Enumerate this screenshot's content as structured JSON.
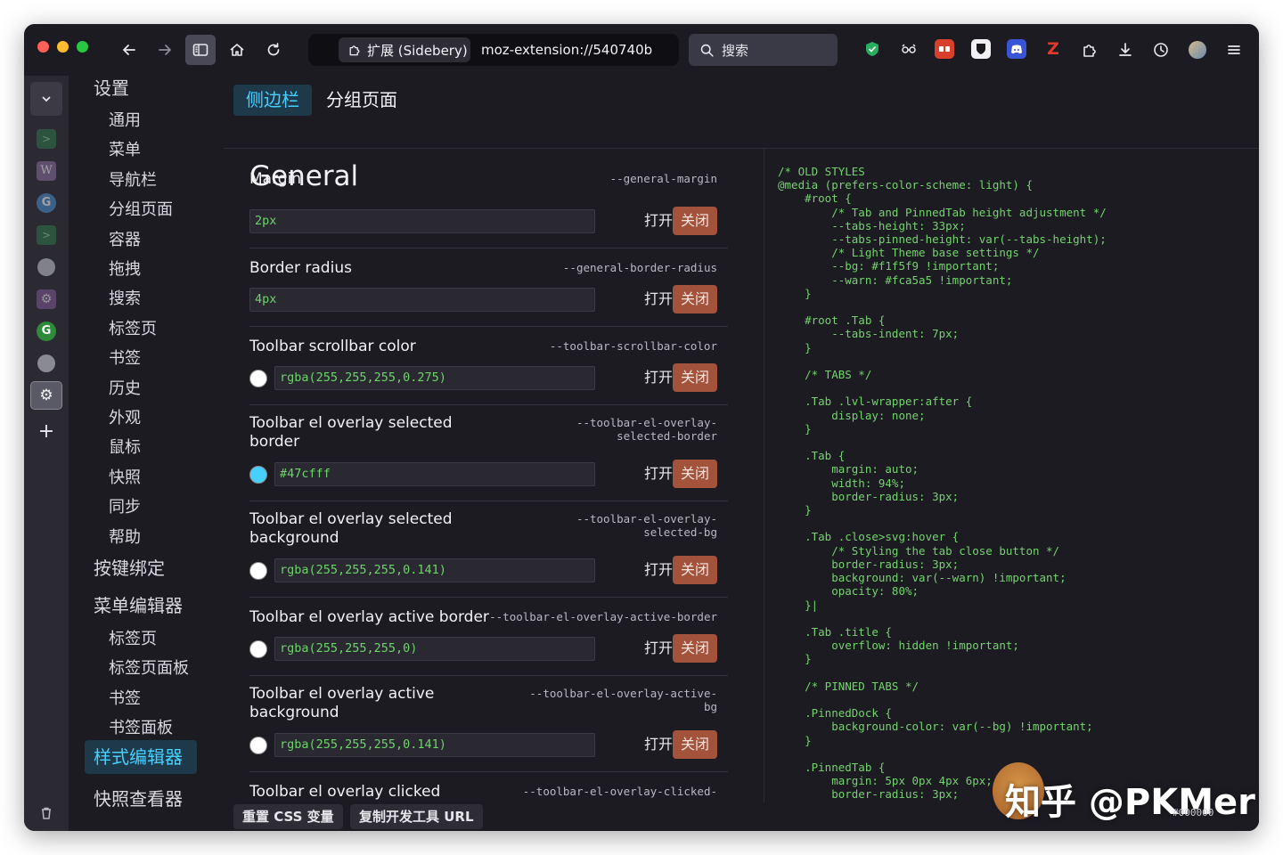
{
  "toolbar": {
    "ext_chip_label": "扩展 (Sidebery)",
    "url": "moz-extension://540740b",
    "search_placeholder": "搜索"
  },
  "nav": {
    "settings_heading": "设置",
    "settings_items": [
      "通用",
      "菜单",
      "导航栏",
      "分组页面",
      "容器",
      "拖拽",
      "搜索",
      "标签页",
      "书签",
      "历史",
      "外观",
      "鼠标",
      "快照",
      "同步",
      "帮助"
    ],
    "keybindings": "按键绑定",
    "menu_editor": "菜单编辑器",
    "menu_editor_items": [
      "标签页",
      "标签页面板",
      "书签",
      "书签面板"
    ],
    "style_editor": "样式编辑器",
    "snapshot_viewer": "快照查看器"
  },
  "tabs": {
    "sidebar": "侧边栏",
    "group_page": "分组页面"
  },
  "settings": {
    "section_title": "General",
    "open_label": "打开",
    "close_label": "关闭",
    "rows": [
      {
        "title": "Margin",
        "var": "--general-margin",
        "value": "2px"
      },
      {
        "title": "Border radius",
        "var": "--general-border-radius",
        "value": "4px"
      },
      {
        "title": "Toolbar scrollbar color",
        "var": "--toolbar-scrollbar-color",
        "value": "rgba(255,255,255,0.275)",
        "color": "#ffffff"
      },
      {
        "title": "Toolbar el overlay selected border",
        "var": "--toolbar-el-overlay-selected-border",
        "value": "#47cfff",
        "color": "#47cfff"
      },
      {
        "title": "Toolbar el overlay selected background",
        "var": "--toolbar-el-overlay-selected-bg",
        "value": "rgba(255,255,255,0.141)",
        "color": "#ffffff"
      },
      {
        "title": "Toolbar el overlay active border",
        "var": "--toolbar-el-overlay-active-border",
        "value": "rgba(255,255,255,0)",
        "color": "#ffffff"
      },
      {
        "title": "Toolbar el overlay active background",
        "var": "--toolbar-el-overlay-active-bg",
        "value": "rgba(255,255,255,0.141)",
        "color": "#ffffff"
      },
      {
        "title": "Toolbar el overlay clicked",
        "var": "--toolbar-el-overlay-clicked-"
      }
    ]
  },
  "editor": {
    "code": "/* OLD STYLES\n@media (prefers-color-scheme: light) {\n    #root {\n        /* Tab and PinnedTab height adjustment */\n        --tabs-height: 33px;\n        --tabs-pinned-height: var(--tabs-height);\n        /* Light Theme base settings */\n        --bg: #f1f5f9 !important;\n        --warn: #fca5a5 !important;\n    }\n\n    #root .Tab {\n        --tabs-indent: 7px;\n    }\n\n    /* TABS */\n\n    .Tab .lvl-wrapper:after {\n        display: none;\n    }\n\n    .Tab {\n        margin: auto;\n        width: 94%;\n        border-radius: 3px;\n    }\n\n    .Tab .close>svg:hover {\n        /* Styling the tab close button */\n        border-radius: 3px;\n        background: var(--warn) !important;\n        opacity: 80%;\n    }|\n\n    .Tab .title {\n        overflow: hidden !important;\n    }\n\n    /* PINNED TABS */\n\n    .PinnedDock {\n        background-color: var(--bg) !important;\n    }\n\n    .PinnedTab {\n        margin: 5px 0px 4px 6px;\n        border-radius: 3px;\n    }"
  },
  "bottom": {
    "reset_css": "重置 CSS 变量",
    "copy_url": "复制开发工具 URL"
  },
  "watermark": {
    "text": "知乎 @PKMer",
    "sub": "#000000"
  },
  "colors": {
    "accent": "#47cfff",
    "close_button": "#a3533b",
    "code_green": "#74d36e",
    "active_nav_bg": "#1e3a4a"
  }
}
